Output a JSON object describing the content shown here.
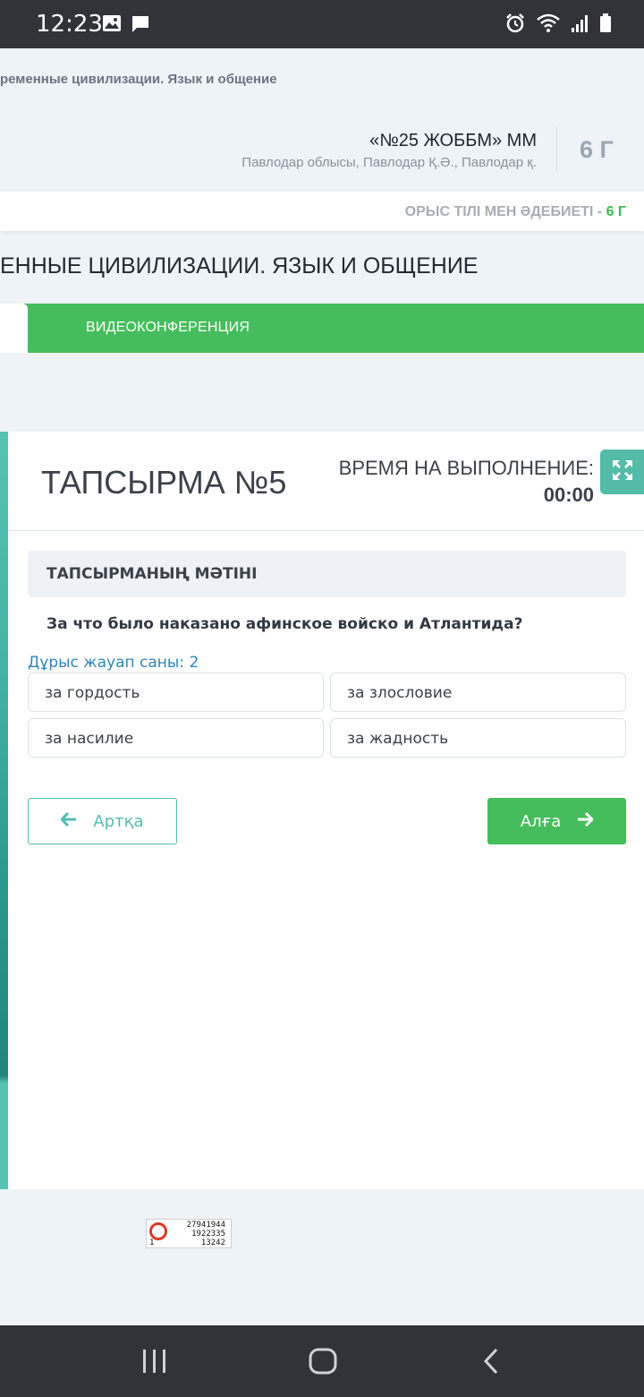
{
  "status_bar": {
    "time": "12:23",
    "icons": [
      "image-icon",
      "message-icon",
      "alarm-icon",
      "wifi-icon",
      "signal-icon",
      "battery-icon"
    ]
  },
  "header": {
    "breadcrumb": "ременные цивилизации. Язык и общение",
    "school_name": "«№25 ЖОББМ» ММ",
    "school_location": "Павлодар облысы, Павлодар Қ.Ә., Павлодар қ.",
    "class_label": "6 Г"
  },
  "subject": {
    "name": "ОРЫС ТІЛІ МЕН ӘДЕБИЕТІ - ",
    "class": "6 Г"
  },
  "lesson_title": "ЕННЫЕ ЦИВИЛИЗАЦИИ. ЯЗЫК И ОБЩЕНИЕ",
  "tabs": {
    "video": "ВИДЕОКОНФЕРЕНЦИЯ"
  },
  "task": {
    "title": "ТАПСЫРМА №5",
    "time_label": "ВРЕМЯ НА ВЫПОЛНЕНИЕ:",
    "time_value": "00:00",
    "text_heading": "ТАПСЫРМАНЫҢ МӘТІНІ",
    "question": "За что было наказано афинское войско и Атлантида?",
    "correct_count": "Дұрыс жауап саны: 2",
    "answers": [
      "за гордость",
      "за злословие",
      "за насилие",
      "за жадность"
    ]
  },
  "navigation": {
    "back_label": "Артқа",
    "next_label": "Алға"
  },
  "counter": {
    "line1": "27941944",
    "line2": "1922335",
    "line3": "13242",
    "line4": "1"
  },
  "colors": {
    "accent_green": "#46bd5c",
    "accent_teal": "#55bcb0",
    "link_blue": "#2f86b6",
    "status_bar": "#313338"
  }
}
